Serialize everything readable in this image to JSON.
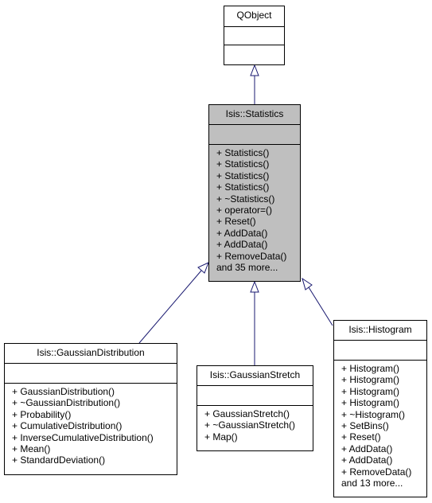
{
  "diagram": {
    "type": "class inheritance graph",
    "nodes": {
      "qobject": {
        "name": "QObject",
        "members": []
      },
      "statistics": {
        "name": "Isis::Statistics",
        "highlighted": true,
        "members": [
          "+ Statistics()",
          "+ Statistics()",
          "+ Statistics()",
          "+ Statistics()",
          "+ ~Statistics()",
          "+ operator=()",
          "+ Reset()",
          "+ AddData()",
          "+ AddData()",
          "+ RemoveData()",
          "and 35 more..."
        ]
      },
      "gaussian_distribution": {
        "name": "Isis::GaussianDistribution",
        "members": [
          "+ GaussianDistribution()",
          "+ ~GaussianDistribution()",
          "+ Probability()",
          "+ CumulativeDistribution()",
          "+ InverseCumulativeDistribution()",
          "+ Mean()",
          "+ StandardDeviation()"
        ]
      },
      "gaussian_stretch": {
        "name": "Isis::GaussianStretch",
        "members": [
          "+ GaussianStretch()",
          "+ ~GaussianStretch()",
          "+ Map()"
        ]
      },
      "histogram": {
        "name": "Isis::Histogram",
        "members": [
          "+ Histogram()",
          "+ Histogram()",
          "+ Histogram()",
          "+ Histogram()",
          "+ ~Histogram()",
          "+ SetBins()",
          "+ Reset()",
          "+ AddData()",
          "+ AddData()",
          "+ RemoveData()",
          "and 13 more..."
        ]
      }
    },
    "edges": [
      {
        "from": "statistics",
        "to": "qobject",
        "kind": "inheritance"
      },
      {
        "from": "gaussian_distribution",
        "to": "statistics",
        "kind": "inheritance"
      },
      {
        "from": "gaussian_stretch",
        "to": "statistics",
        "kind": "inheritance"
      },
      {
        "from": "histogram",
        "to": "statistics",
        "kind": "inheritance"
      }
    ],
    "colors": {
      "edge": "#191970",
      "highlight_fill": "#bfbfbf",
      "node_border": "#000000"
    }
  }
}
